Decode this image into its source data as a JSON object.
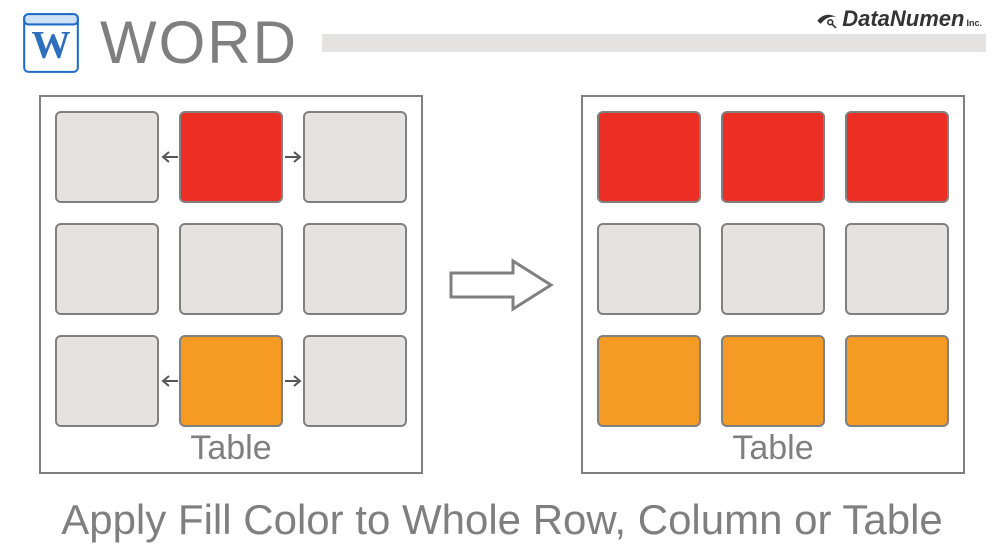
{
  "header": {
    "title": "WORD",
    "brand": "DataNumen",
    "brand_suffix": "Inc."
  },
  "left_table": {
    "label": "Table",
    "cells": [
      [
        "gray",
        "red",
        "gray"
      ],
      [
        "gray",
        "gray",
        "gray"
      ],
      [
        "gray",
        "orange",
        "gray"
      ]
    ]
  },
  "right_table": {
    "label": "Table",
    "cells": [
      [
        "red",
        "red",
        "red"
      ],
      [
        "gray",
        "gray",
        "gray"
      ],
      [
        "orange",
        "orange",
        "orange"
      ]
    ]
  },
  "caption": "Apply Fill Color to Whole Row, Column or Table",
  "colors": {
    "gray": "#e4e3e2",
    "red": "#ed2e24",
    "orange": "#f59a22",
    "border": "#808080",
    "text": "#7f7f7f"
  }
}
